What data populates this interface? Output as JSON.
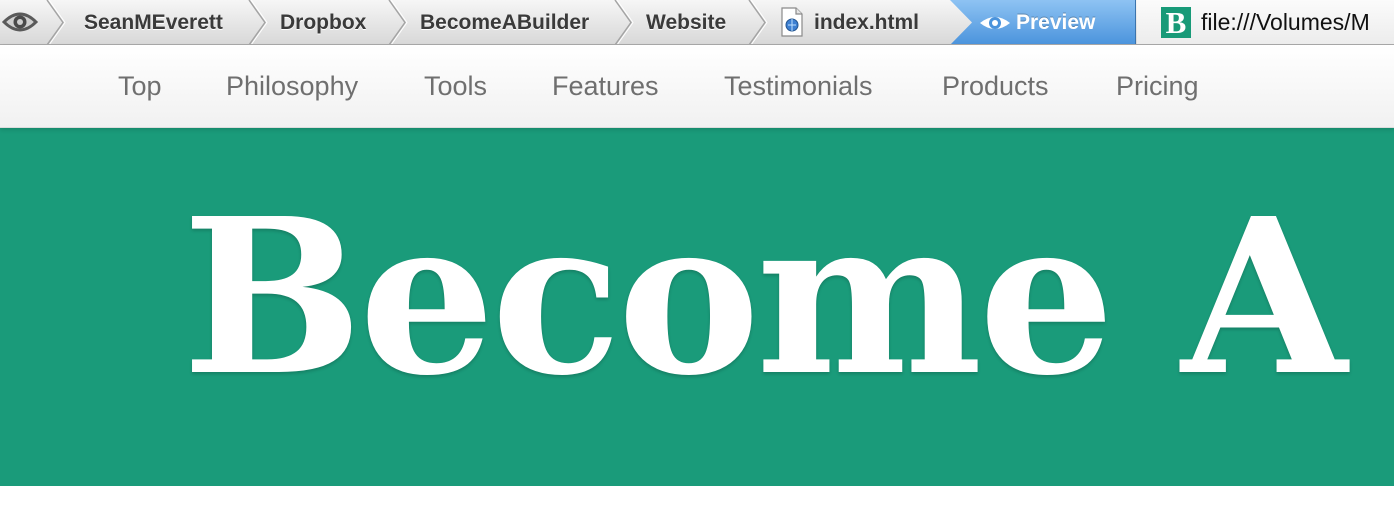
{
  "pathbar": {
    "root_icon": "eye-outline-icon",
    "crumbs": [
      {
        "label": "SeanMEverett"
      },
      {
        "label": "Dropbox"
      },
      {
        "label": "BecomeABuilder"
      },
      {
        "label": "Website"
      },
      {
        "label": "index.html",
        "icon": "html-file-icon"
      }
    ],
    "preview": {
      "label": "Preview",
      "icon": "eye-icon"
    },
    "url": {
      "favicon_letter": "B",
      "text": "file:///Volumes/M"
    }
  },
  "nav": {
    "items": [
      {
        "label": "Top"
      },
      {
        "label": "Philosophy"
      },
      {
        "label": "Tools"
      },
      {
        "label": "Features"
      },
      {
        "label": "Testimonials"
      },
      {
        "label": "Products"
      },
      {
        "label": "Pricing"
      }
    ]
  },
  "hero": {
    "title": "Become A",
    "background_color": "#1a9b7a"
  }
}
